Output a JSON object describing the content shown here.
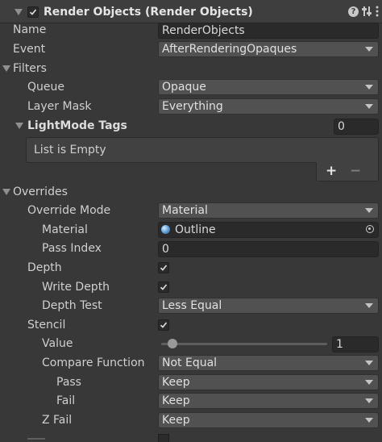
{
  "header": {
    "title": "Render Objects (Render Objects)",
    "enabled": true
  },
  "fields": {
    "name": {
      "label": "Name",
      "value": "RenderObjects"
    },
    "event": {
      "label": "Event",
      "value": "AfterRenderingOpaques"
    }
  },
  "filters": {
    "title": "Filters",
    "queue": {
      "label": "Queue",
      "value": "Opaque"
    },
    "layer_mask": {
      "label": "Layer Mask",
      "value": "Everything"
    },
    "lightmode_tags": {
      "label": "LightMode Tags",
      "count": "0",
      "empty_text": "List is Empty",
      "add_label": "+",
      "remove_label": "−"
    }
  },
  "overrides": {
    "title": "Overrides",
    "override_mode": {
      "label": "Override Mode",
      "value": "Material"
    },
    "material": {
      "label": "Material",
      "value": "Outline"
    },
    "pass_index": {
      "label": "Pass Index",
      "value": "0"
    },
    "depth": {
      "label": "Depth",
      "checked": true
    },
    "write_depth": {
      "label": "Write Depth",
      "checked": true
    },
    "depth_test": {
      "label": "Depth Test",
      "value": "Less Equal"
    },
    "stencil": {
      "label": "Stencil",
      "checked": true
    },
    "stencil_value": {
      "label": "Value",
      "value": "1",
      "slider_fraction": 0.0
    },
    "compare_function": {
      "label": "Compare Function",
      "value": "Not Equal"
    },
    "pass": {
      "label": "Pass",
      "value": "Keep"
    },
    "fail": {
      "label": "Fail",
      "value": "Keep"
    },
    "z_fail": {
      "label": "Z Fail",
      "value": "Keep"
    }
  },
  "icons": [
    "foldout-arrow-icon",
    "checkmark-icon",
    "help-icon",
    "preset-icon",
    "menu-dots-icon",
    "material-sphere-icon",
    "object-picker-icon",
    "dropdown-arrow-icon"
  ],
  "colors": {
    "background": "#383838",
    "header_background": "#3e3e3e",
    "field_background": "#2a2a2a",
    "dropdown_background": "#515151",
    "text": "#cfcfcf"
  }
}
